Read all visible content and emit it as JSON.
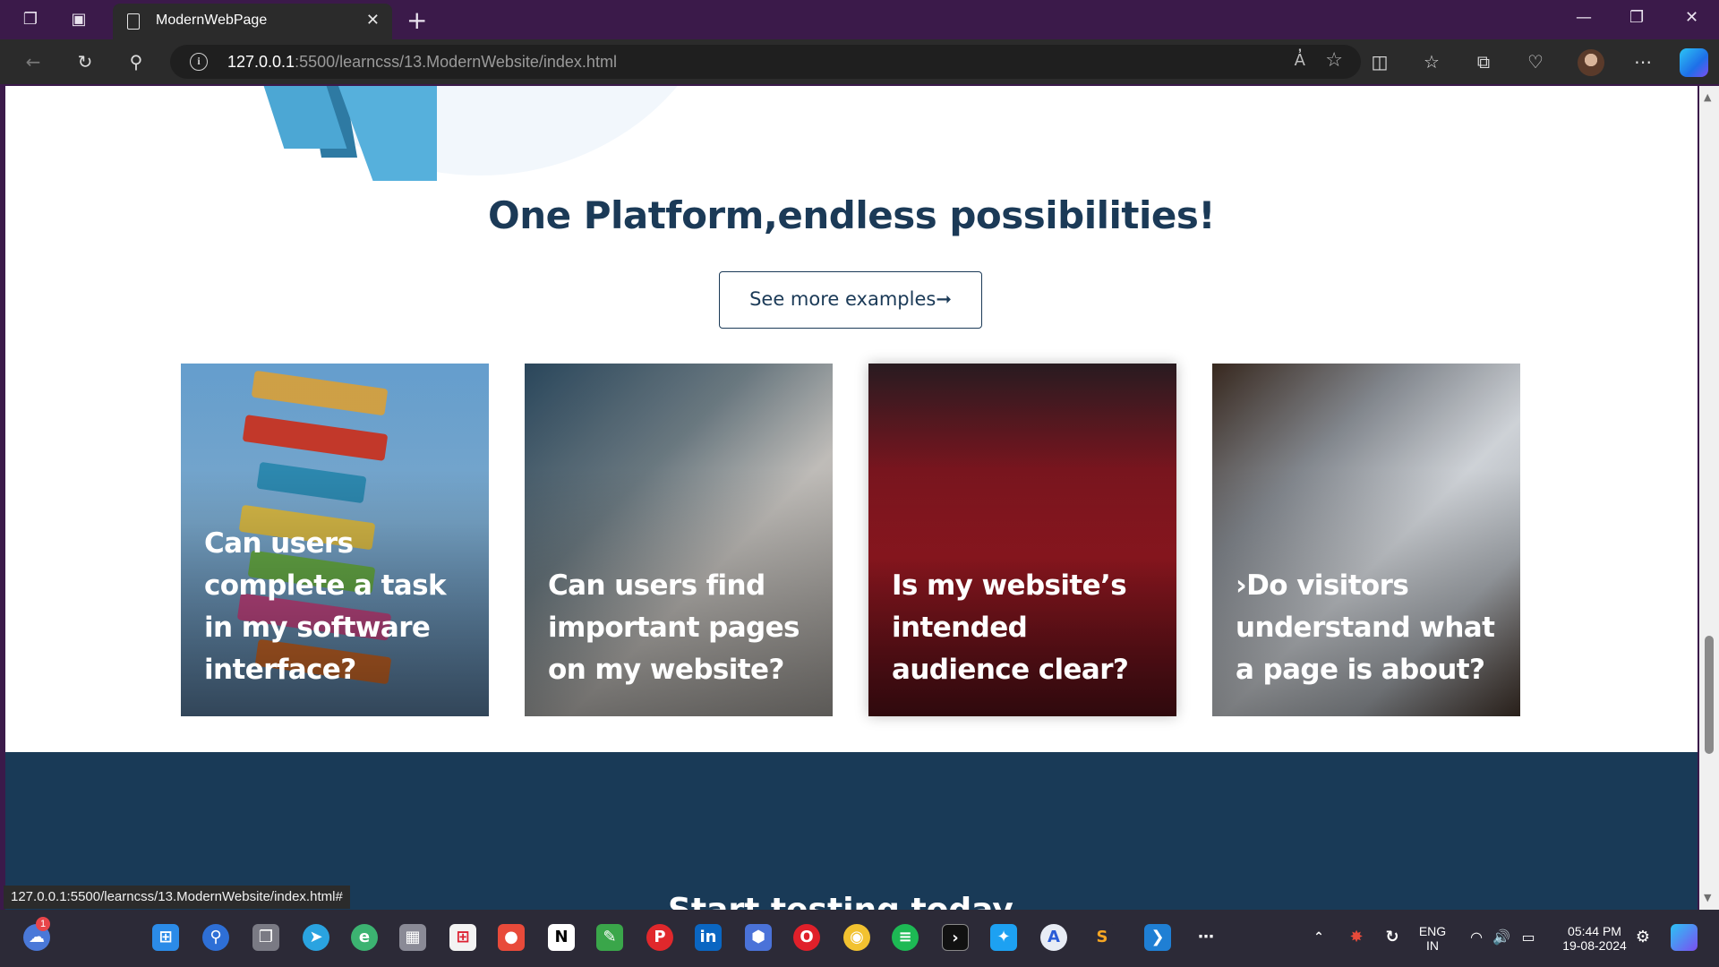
{
  "browser": {
    "tab_title": "ModernWebPage",
    "url_host": "127.0.0.1",
    "url_rest": ":5500/learncss/13.ModernWebsite/index.html",
    "read_aloud_label": "A̓"
  },
  "page": {
    "headline": "One Platform,endless possibilities!",
    "cta_label": "See more examples➞",
    "cards": [
      {
        "caption": "Can users complete a task in my software interface?"
      },
      {
        "caption": "Can users find important pages on my website?"
      },
      {
        "caption": "Is my website’s intended audience clear?"
      },
      {
        "caption": "›Do visitors understand what a page is about?"
      }
    ],
    "footer_peek": "Start testing today"
  },
  "status_bar": {
    "link_preview": "127.0.0.1:5500/learncss/13.ModernWebsite/index.html#"
  },
  "taskbar": {
    "notification_count": "1",
    "language_top": "ENG",
    "language_bottom": "IN",
    "time": "05:44 PM",
    "date": "19-08-2024"
  },
  "colors": {
    "title_bar": "#3b1a4a",
    "headline": "#1b3a57",
    "footer_band": "#193a57"
  }
}
